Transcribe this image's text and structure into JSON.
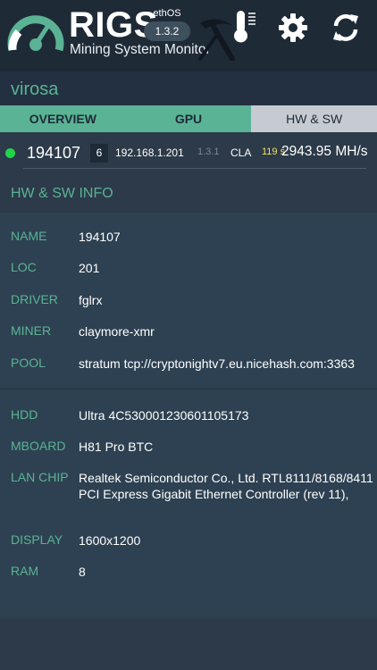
{
  "header": {
    "app_title": "RIGS",
    "app_subtitle": "Mining System Monitor",
    "os_label": "ethOS",
    "os_version": "1.3.2"
  },
  "rig": {
    "name": "virosa"
  },
  "tabs": [
    {
      "label": "OVERVIEW",
      "active": false
    },
    {
      "label": "GPU",
      "active": false
    },
    {
      "label": "HW & SW",
      "active": true
    }
  ],
  "summary": {
    "rig_id": "194107",
    "gpu_count": "6",
    "ip": "192.168.1.201",
    "version": "1.3.1",
    "miner_short": "CLA",
    "temp": "119 s",
    "hashrate": "2943.95 MH/s",
    "status_color": "#23d34a"
  },
  "info": {
    "title": "HW & SW INFO",
    "software": [
      {
        "label": "NAME",
        "value": "194107"
      },
      {
        "label": "LOC",
        "value": "201"
      },
      {
        "label": "DRIVER",
        "value": "fglrx"
      },
      {
        "label": "MINER",
        "value": "claymore-xmr"
      },
      {
        "label": "POOL",
        "value": "stratum tcp://cryptonightv7.eu.nicehash.com:3363"
      }
    ],
    "hardware": [
      {
        "label": "HDD",
        "value": "Ultra 4C530001230601105173"
      },
      {
        "label": "MBOARD",
        "value": "H81 Pro BTC"
      },
      {
        "label": "LAN CHIP",
        "value": "Realtek Semiconductor Co., Ltd. RTL8111/8168/8411 PCI Express Gigabit Ethernet Controller (rev 11),"
      },
      {
        "label": "DISPLAY",
        "value": "1600x1200"
      },
      {
        "label": "RAM",
        "value": "8"
      }
    ]
  },
  "colors": {
    "accent": "#5ab394",
    "header_bg": "#1f2a37",
    "body_bg": "#2c3a49",
    "panel_bg": "#2e4152",
    "temp": "#f2e15a"
  }
}
